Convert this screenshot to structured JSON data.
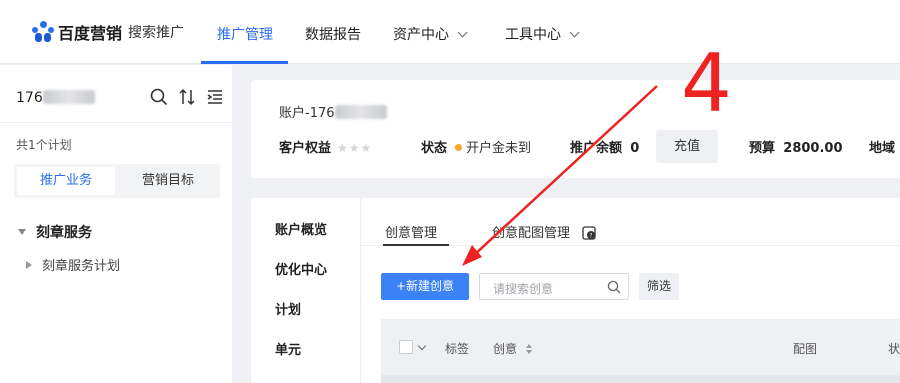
{
  "header": {
    "logo_main": "百度营销",
    "logo_sub": "搜索推广",
    "nav": [
      {
        "label": "推广管理",
        "active": true
      },
      {
        "label": "数据报告",
        "active": false
      },
      {
        "label": "资产中心",
        "active": false,
        "dropdown": true
      },
      {
        "label": "工具中心",
        "active": false,
        "dropdown": true
      }
    ]
  },
  "sidebar": {
    "account_prefix": "176",
    "plan_count": "共1个计划",
    "segments": [
      "推广业务",
      "营销目标"
    ],
    "tree_group": "刻章服务",
    "tree_item": "刻章服务计划"
  },
  "account_card": {
    "account_prefix": "账户-176",
    "rights_label": "客户权益",
    "stars": "★★★",
    "status_label": "状态",
    "status_value": "开户金未到",
    "balance_label": "推广余额",
    "balance_value": "0",
    "recharge_label": "充值",
    "budget_label": "预算",
    "budget_value": "2800.00",
    "region_label": "地域"
  },
  "menu": [
    "账户概览",
    "优化中心",
    "计划",
    "单元"
  ],
  "tabs": [
    "创意管理",
    "创意配图管理"
  ],
  "toolbar": {
    "new_button": "+新建创意",
    "search_placeholder": "请搜索创意",
    "filter_label": "筛选"
  },
  "table": {
    "columns": [
      "标签",
      "创意",
      "配图",
      "状"
    ]
  },
  "annotation": {
    "number": "4",
    "color": "#ef2222"
  },
  "colors": {
    "accent": "#2a6ef0",
    "primary_button": "#3b82f6",
    "status_dot": "#f5a623"
  }
}
